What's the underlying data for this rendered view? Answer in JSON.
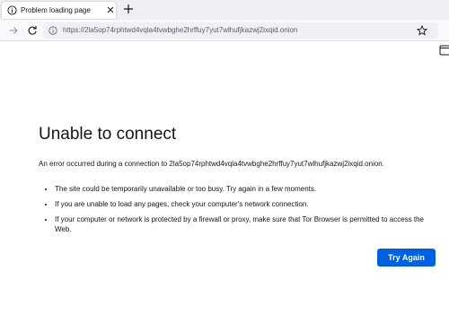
{
  "tab": {
    "title": "Problem loading page",
    "icon": "info-icon"
  },
  "toolbar": {
    "url": "https://2la5op74rphtwd4vqla4tvwbghe2hrffuy7yut7wlhufjkazwj2ixqid.onion"
  },
  "error": {
    "title": "Unable to connect",
    "description": "An error occurred during a connection to 2la5op74rphtwd4vqla4tvwbghe2hrffuy7yut7wlhufjkazwj2ixqid.onion.",
    "reasons": [
      "The site could be temporarily unavailable or too busy. Try again in a few moments.",
      "If you are unable to load any pages, check your computer's network connection.",
      "If your computer or network is protected by a firewall or proxy, make sure that Tor Browser is permitted to access the Web."
    ],
    "button_label": "Try Again"
  },
  "colors": {
    "accent": "#0061e0",
    "tabstrip": "#f0f0f4",
    "urlbar": "#f0f0f4"
  }
}
